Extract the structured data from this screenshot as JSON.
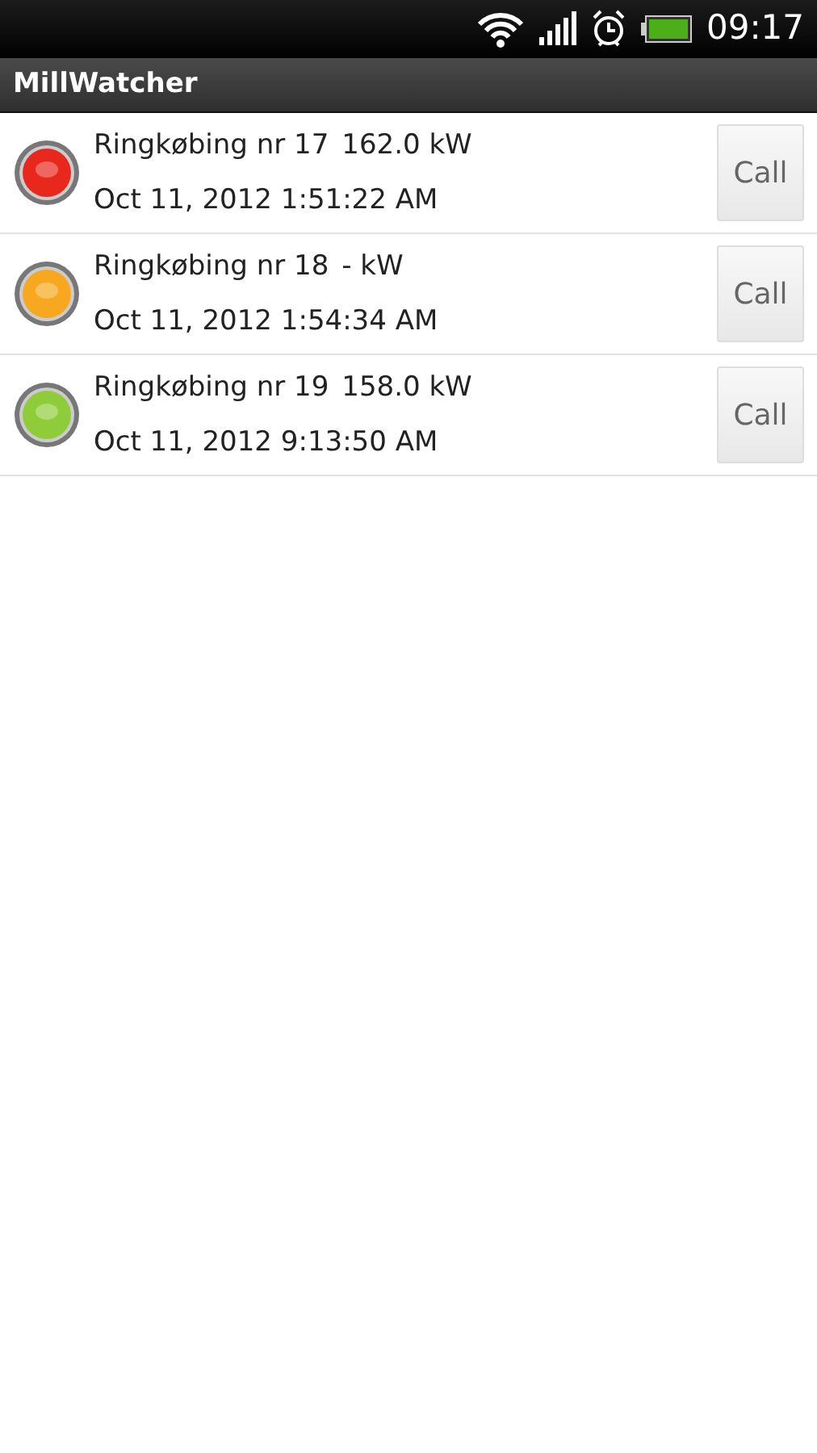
{
  "status_bar": {
    "time": "09:17"
  },
  "app_bar": {
    "title": "MillWatcher"
  },
  "mills": [
    {
      "name": "Ringkøbing nr 17",
      "power": "162.0 kW",
      "timestamp": "Oct 11, 2012 1:51:22 AM",
      "color": "#e8281c",
      "button": "Call"
    },
    {
      "name": "Ringkøbing nr 18",
      "power": "- kW",
      "timestamp": "Oct 11, 2012 1:54:34 AM",
      "color": "#f7a81e",
      "button": "Call"
    },
    {
      "name": "Ringkøbing nr 19",
      "power": "158.0 kW",
      "timestamp": "Oct 11, 2012 9:13:50 AM",
      "color": "#8fcc3a",
      "button": "Call"
    }
  ]
}
